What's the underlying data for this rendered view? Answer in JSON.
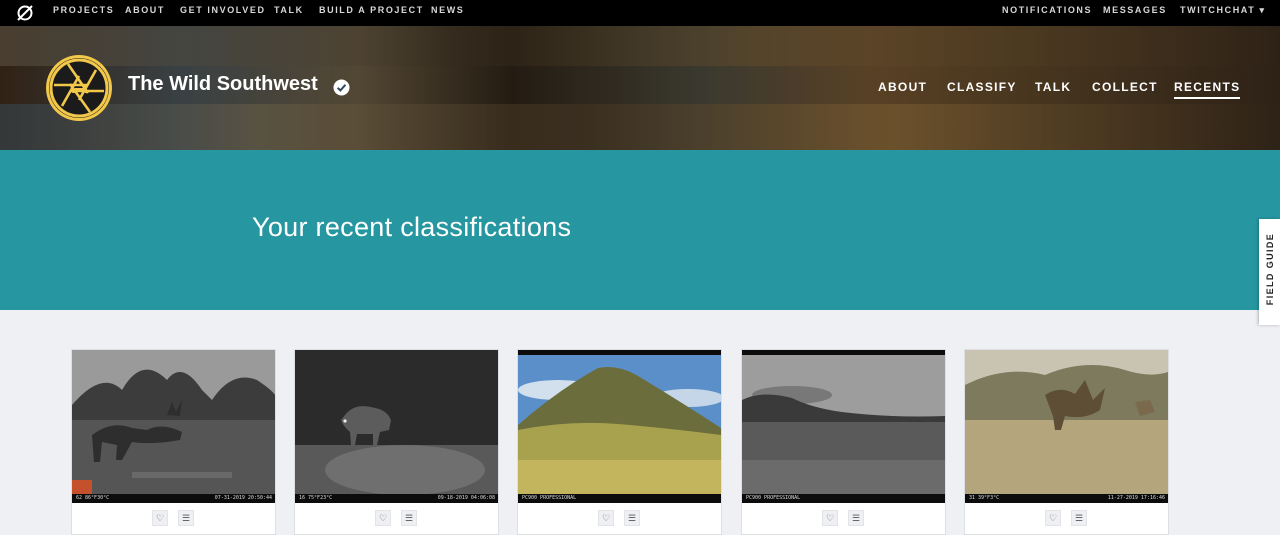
{
  "topnav": {
    "left": [
      "PROJECTS",
      "ABOUT",
      "GET INVOLVED",
      "TALK",
      "BUILD A PROJECT",
      "NEWS"
    ],
    "right": [
      "NOTIFICATIONS",
      "MESSAGES",
      "TWITCHCHAT"
    ]
  },
  "project": {
    "title": "The Wild Southwest",
    "nav": [
      "ABOUT",
      "CLASSIFY",
      "TALK",
      "COLLECT",
      "RECENTS"
    ],
    "active_nav": "RECENTS"
  },
  "banner": {
    "heading": "Your recent classifications"
  },
  "field_guide": "FIELD GUIDE",
  "colors": {
    "accent": "#2696a0",
    "logo_ring": "#f2c84b"
  },
  "cards": [
    {
      "kind": "elk-grayscale",
      "stamp_left": "62  86°F30°C",
      "stamp_right": "07-31-2019 20:50:44"
    },
    {
      "kind": "boar-night",
      "stamp_left": "16  75°F23°C",
      "stamp_right": "09-18-2019 04:06:08"
    },
    {
      "kind": "mountain-color",
      "stamp_left": "PC900 PROFESSIONAL",
      "stamp_right": ""
    },
    {
      "kind": "mountain-grayscale",
      "stamp_left": "PC900 PROFESSIONAL",
      "stamp_right": ""
    },
    {
      "kind": "boar-color",
      "stamp_left": "31  39°F3°C",
      "stamp_right": "11-27-2019 17:16:46"
    }
  ]
}
